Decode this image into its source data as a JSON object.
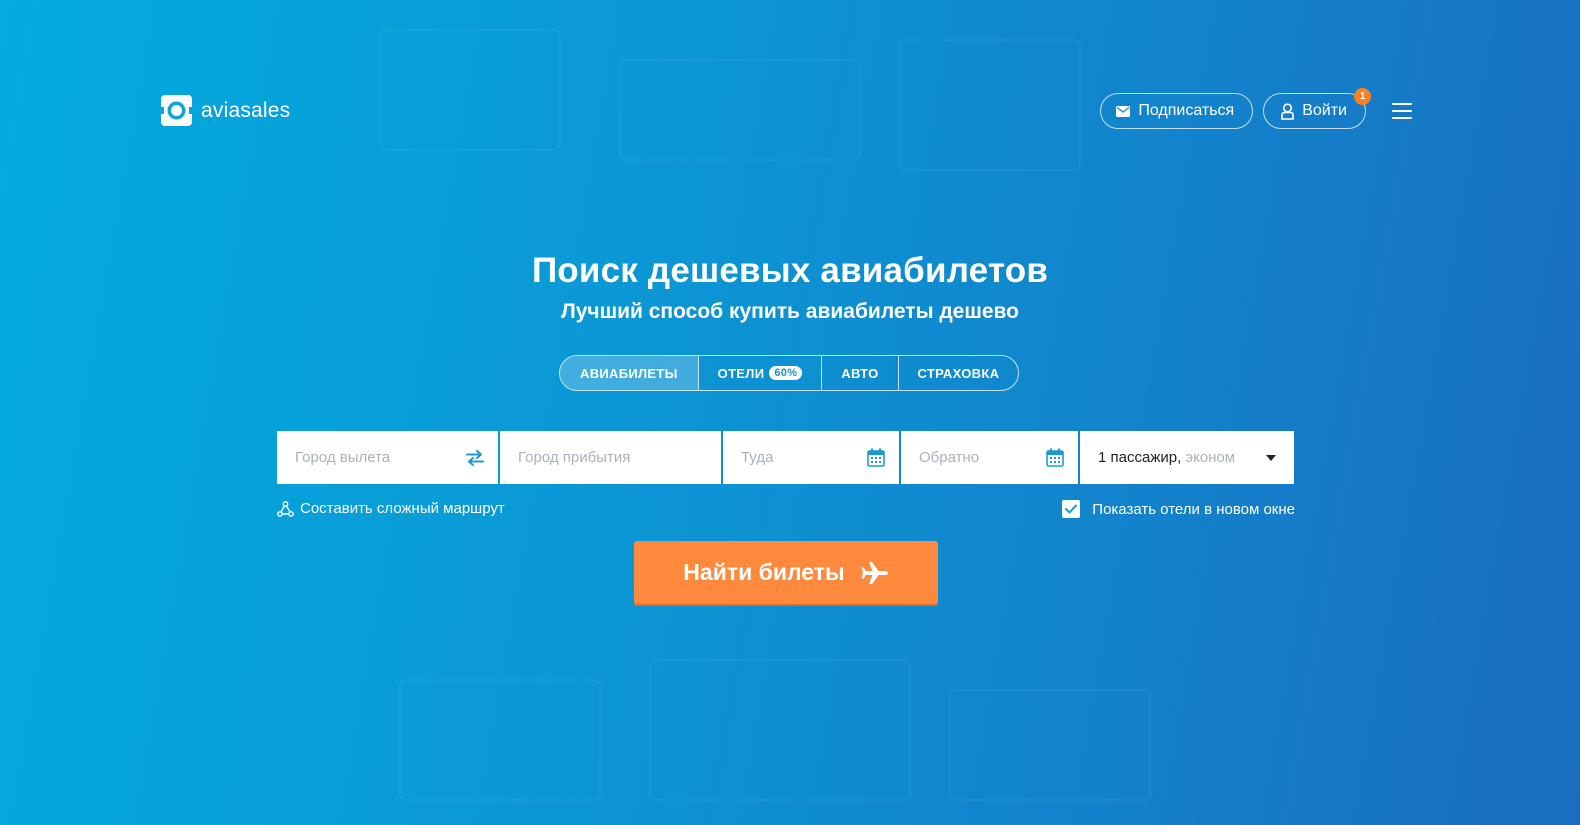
{
  "header": {
    "brand": "aviasales",
    "subscribe_label": "Подписаться",
    "login_label": "Войти",
    "notification_count": "1"
  },
  "hero": {
    "title": "Поиск дешевых авиабилетов",
    "subtitle": "Лучший способ купить авиабилеты дешево"
  },
  "tabs": [
    {
      "label": "АВИАБИЛЕТЫ",
      "active": true
    },
    {
      "label": "ОТЕЛИ",
      "badge": "60%"
    },
    {
      "label": "АВТО"
    },
    {
      "label": "СТРАХОВКА"
    }
  ],
  "search": {
    "origin_placeholder": "Город вылета",
    "destination_placeholder": "Город прибытия",
    "depart_placeholder": "Туда",
    "return_placeholder": "Обратно",
    "passengers": "1 пассажир,",
    "cabin_class": "эконом",
    "complex_route_label": "Составить сложный маршрут",
    "hotels_new_window_label": "Показать отели в новом окне",
    "hotels_new_window_checked": true,
    "submit_label": "Найти билеты"
  },
  "colors": {
    "accent": "#ff8a3d",
    "background_start": "#03abe0",
    "background_end": "#1a6dbe",
    "icon_blue": "#1d9ad6"
  }
}
